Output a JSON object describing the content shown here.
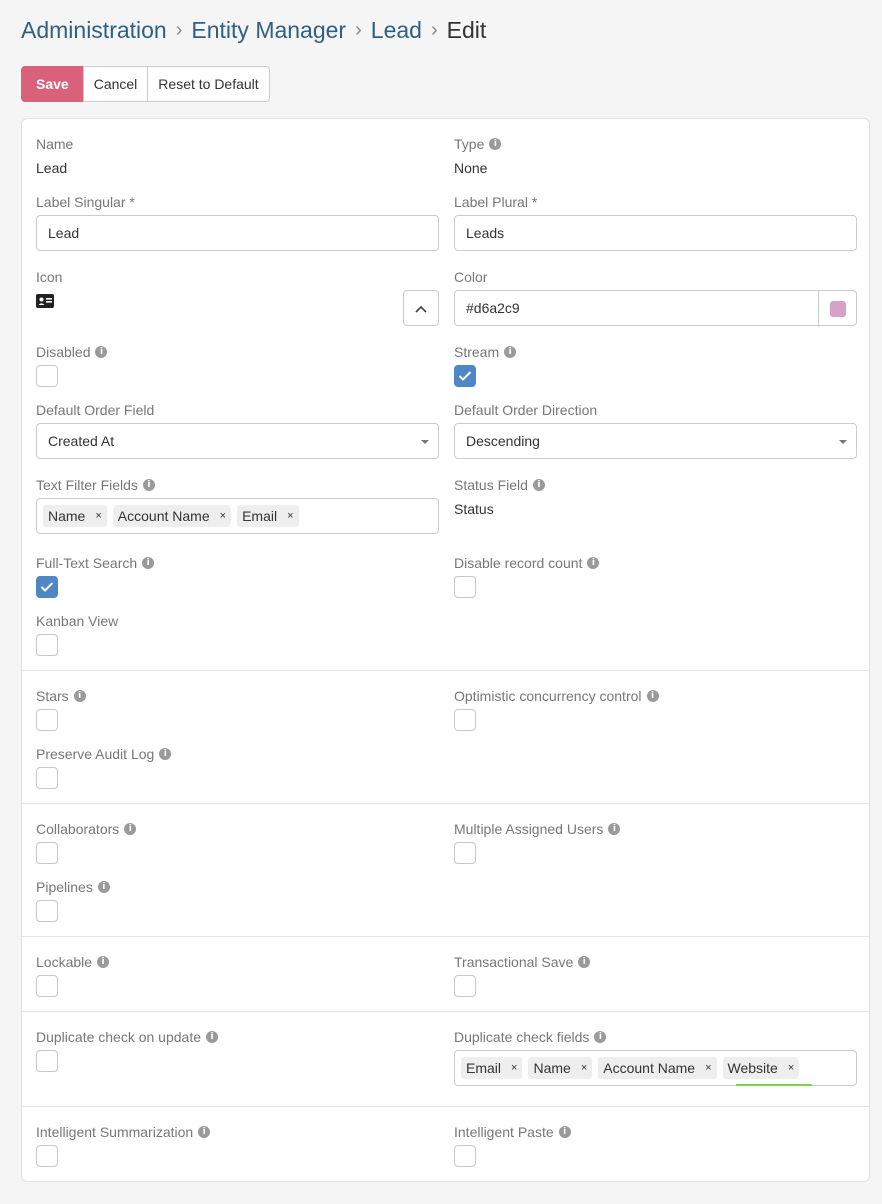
{
  "breadcrumb": {
    "items": [
      "Administration",
      "Entity Manager",
      "Lead"
    ],
    "current": "Edit",
    "separator": "›"
  },
  "buttons": {
    "save": "Save",
    "cancel": "Cancel",
    "reset": "Reset to Default"
  },
  "fields": {
    "name": {
      "label": "Name",
      "value": "Lead"
    },
    "type": {
      "label": "Type",
      "value": "None"
    },
    "label_singular": {
      "label": "Label Singular *",
      "value": "Lead"
    },
    "label_plural": {
      "label": "Label Plural *",
      "value": "Leads"
    },
    "icon": {
      "label": "Icon",
      "icon_name": "id-card-icon"
    },
    "color": {
      "label": "Color",
      "value": "#d6a2c9"
    },
    "disabled": {
      "label": "Disabled",
      "checked": false
    },
    "stream": {
      "label": "Stream",
      "checked": true
    },
    "default_order_field": {
      "label": "Default Order Field",
      "value": "Created At"
    },
    "default_order_direction": {
      "label": "Default Order Direction",
      "value": "Descending"
    },
    "text_filter_fields": {
      "label": "Text Filter Fields",
      "tags": [
        "Name",
        "Account Name",
        "Email"
      ]
    },
    "status_field": {
      "label": "Status Field",
      "value": "Status"
    },
    "full_text_search": {
      "label": "Full-Text Search",
      "checked": true
    },
    "disable_record_count": {
      "label": "Disable record count",
      "checked": false
    },
    "kanban_view": {
      "label": "Kanban View",
      "checked": false
    },
    "stars": {
      "label": "Stars",
      "checked": false
    },
    "optimistic_concurrency": {
      "label": "Optimistic concurrency control",
      "checked": false
    },
    "preserve_audit_log": {
      "label": "Preserve Audit Log",
      "checked": false
    },
    "collaborators": {
      "label": "Collaborators",
      "checked": false
    },
    "multiple_assigned_users": {
      "label": "Multiple Assigned Users",
      "checked": false
    },
    "pipelines": {
      "label": "Pipelines",
      "checked": false
    },
    "lockable": {
      "label": "Lockable",
      "checked": false
    },
    "transactional_save": {
      "label": "Transactional Save",
      "checked": false
    },
    "duplicate_check_on_update": {
      "label": "Duplicate check on update",
      "checked": false
    },
    "duplicate_check_fields": {
      "label": "Duplicate check fields",
      "tags": [
        "Email",
        "Name",
        "Account Name",
        "Website"
      ]
    },
    "intelligent_summarization": {
      "label": "Intelligent Summarization",
      "checked": false
    },
    "intelligent_paste": {
      "label": "Intelligent Paste",
      "checked": false
    }
  },
  "icons": {
    "info": "info-icon",
    "tag_remove": "×",
    "check": "check-icon",
    "chevron_up": "chevron-up-icon"
  },
  "colors": {
    "primary": "#d9617a",
    "checkbox_on": "#4f86c6",
    "link": "#2f5f85"
  }
}
